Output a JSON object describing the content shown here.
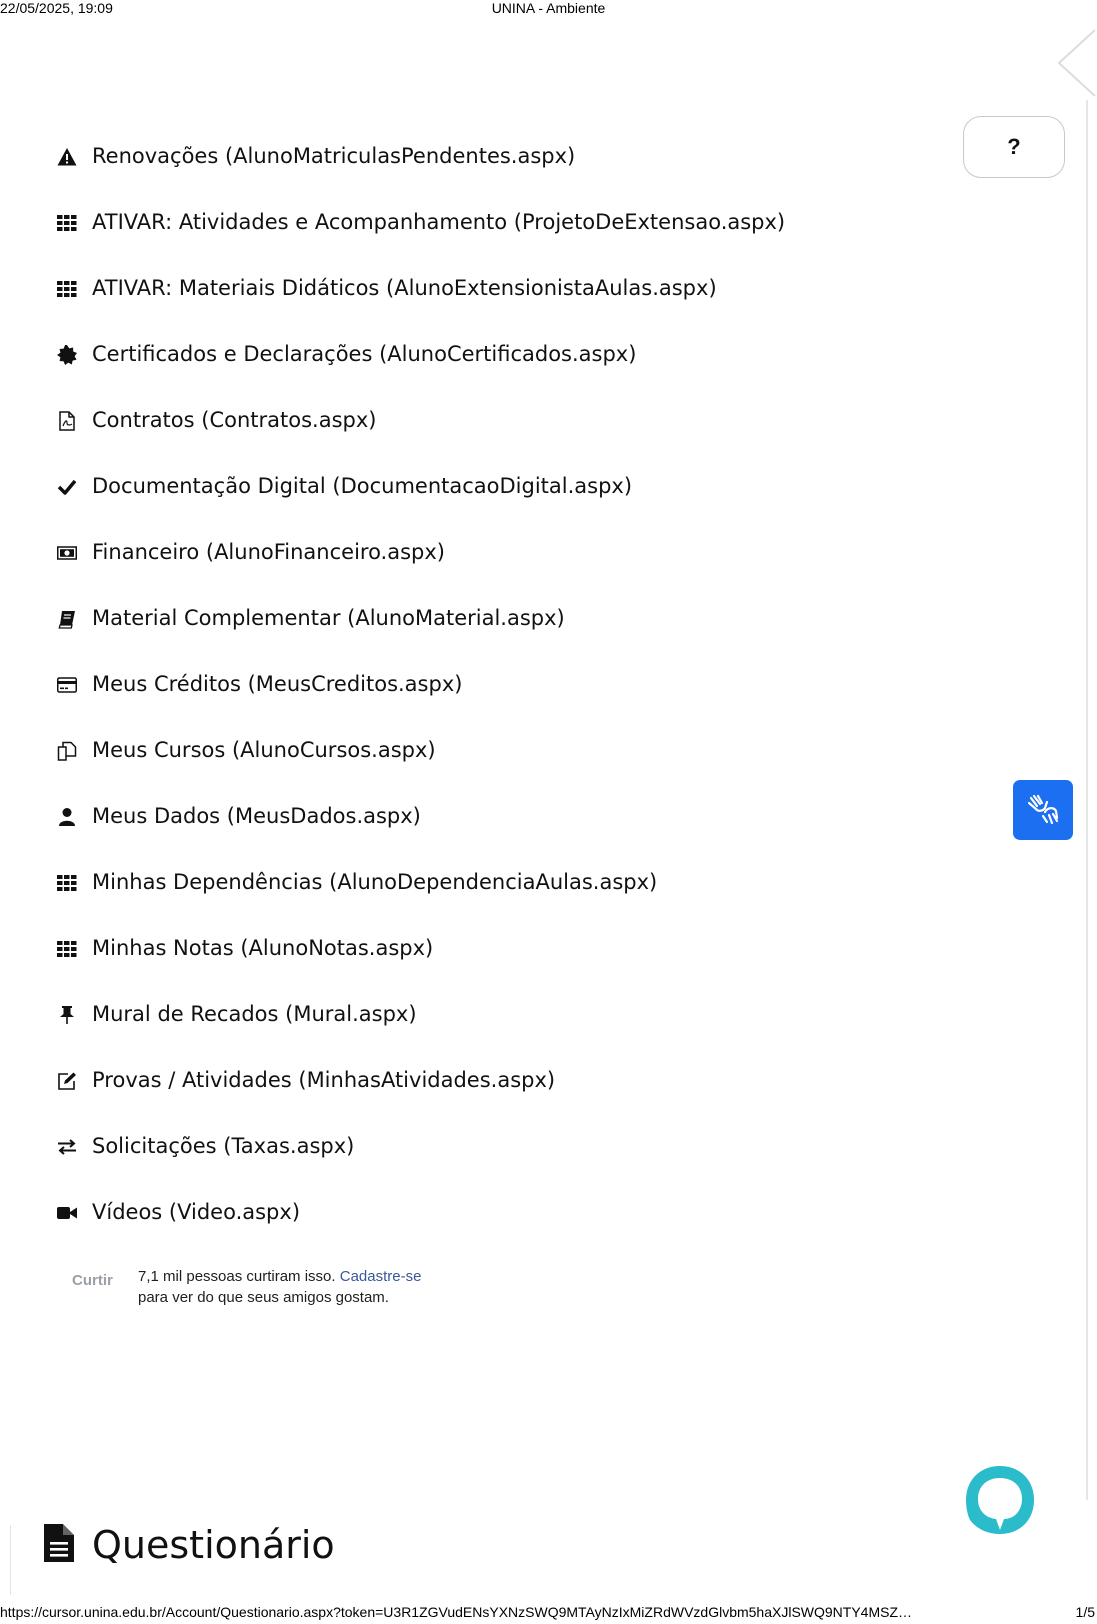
{
  "print_header": {
    "date": "22/05/2025, 19:09",
    "title": "UNINA - Ambiente"
  },
  "print_footer": {
    "url": "https://cursor.unina.edu.br/Account/Questionario.aspx?token=U3R1ZGVudENsYXNzSWQ9MTAyNzIxMiZRdWVzdGlvbm5haXJlSWQ9NTY4MSZ…",
    "page": "1/5"
  },
  "help_button": {
    "label": "?"
  },
  "menu": {
    "items": [
      {
        "icon": "warning-icon",
        "label": "Renovações (AlunoMatriculasPendentes.aspx)"
      },
      {
        "icon": "grid-icon",
        "label": "ATIVAR: Atividades e Acompanhamento (ProjetoDeExtensao.aspx)"
      },
      {
        "icon": "grid-icon",
        "label": "ATIVAR: Materiais Didáticos (AlunoExtensionistaAulas.aspx)"
      },
      {
        "icon": "certificate-icon",
        "label": "Certificados e Declarações (AlunoCertificados.aspx)"
      },
      {
        "icon": "pdf-file-icon",
        "label": "Contratos (Contratos.aspx)"
      },
      {
        "icon": "check-icon",
        "label": "Documentação Digital (DocumentacaoDigital.aspx)"
      },
      {
        "icon": "money-icon",
        "label": "Financeiro (AlunoFinanceiro.aspx)"
      },
      {
        "icon": "book-icon",
        "label": "Material Complementar (AlunoMaterial.aspx)"
      },
      {
        "icon": "credit-card-icon",
        "label": "Meus Créditos (MeusCreditos.aspx)"
      },
      {
        "icon": "copy-icon",
        "label": "Meus Cursos (AlunoCursos.aspx)"
      },
      {
        "icon": "user-icon",
        "label": "Meus Dados (MeusDados.aspx)"
      },
      {
        "icon": "grid-icon",
        "label": "Minhas Dependências (AlunoDependenciaAulas.aspx)"
      },
      {
        "icon": "grid-icon",
        "label": "Minhas Notas (AlunoNotas.aspx)"
      },
      {
        "icon": "pin-icon",
        "label": "Mural de Recados (Mural.aspx)"
      },
      {
        "icon": "edit-icon",
        "label": "Provas / Atividades (MinhasAtividades.aspx)"
      },
      {
        "icon": "exchange-icon",
        "label": "Solicitações (Taxas.aspx)"
      },
      {
        "icon": "video-camera-icon",
        "label": "Vídeos (Video.aspx)"
      }
    ]
  },
  "facebook_like": {
    "button_label": "Curtir",
    "count_text": "7,1 mil pessoas curtiram isso.",
    "signup_link": "Cadastre-se",
    "after_text": "para ver do que seus amigos gostam."
  },
  "section": {
    "title": "Questionário",
    "icon": "file-text-icon"
  },
  "colors": {
    "vlibras_blue": "#1d6ff2",
    "chat_teal": "#2bbccc",
    "link_blue": "#385898"
  }
}
